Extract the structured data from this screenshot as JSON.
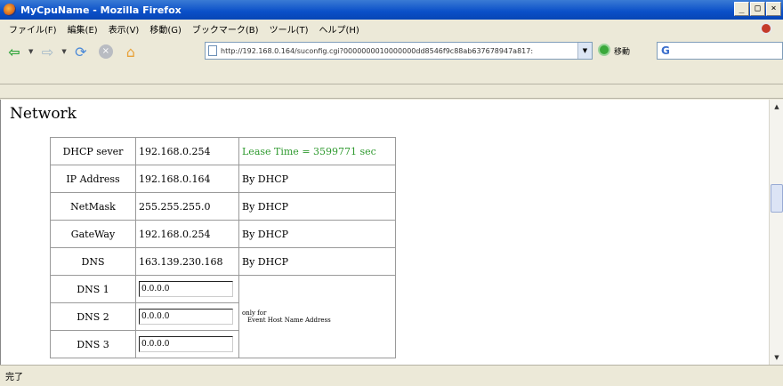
{
  "window": {
    "title": "MyCpuName - Mozilla Firefox"
  },
  "menu": [
    "ファイル(F)",
    "編集(E)",
    "表示(V)",
    "移動(G)",
    "ブックマーク(B)",
    "ツール(T)",
    "ヘルプ(H)"
  ],
  "nav": {
    "url": "http://192.168.0.164/suconfig.cgi?0000000010000000dd8546f9c88ab637678947a817:",
    "go_label": "移動",
    "search_icon": "G"
  },
  "page": {
    "title": "Network",
    "rows": [
      {
        "label": "DHCP sever",
        "value": "192.168.0.254",
        "note": "Lease Time = 3599771 sec"
      },
      {
        "label": "IP Address",
        "value": "192.168.0.164",
        "note": "By DHCP"
      },
      {
        "label": "NetMask",
        "value": "255.255.255.0",
        "note": "By DHCP"
      },
      {
        "label": "GateWay",
        "value": "192.168.0.254",
        "note": "By DHCP"
      },
      {
        "label": "DNS",
        "value": "163.139.230.168",
        "note": "By DHCP"
      }
    ],
    "dns_inputs": [
      {
        "label": "DNS 1",
        "value": "0.0.0.0"
      },
      {
        "label": "DNS 2",
        "value": "0.0.0.0"
      },
      {
        "label": "DNS 3",
        "value": "0.0.0.0"
      }
    ],
    "dns_note_line1": "only for",
    "dns_note_line2": "Event Host Name Address"
  },
  "status": {
    "text": "完了"
  },
  "colors": {
    "titlebar": "#0a4fc8",
    "lease_text": "#2f9a2f"
  }
}
